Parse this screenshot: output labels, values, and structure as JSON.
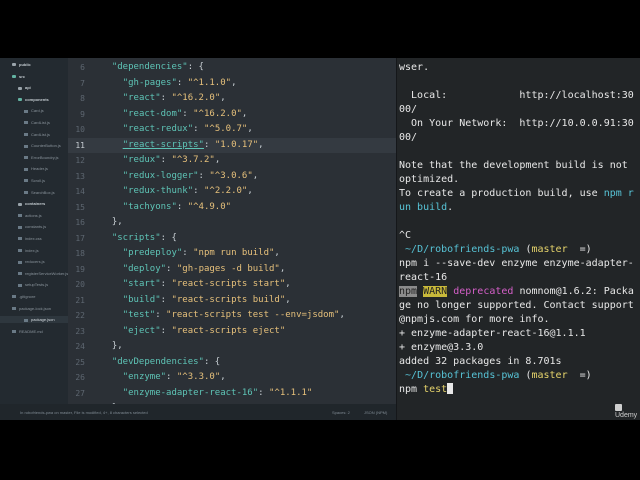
{
  "sidebar": {
    "items": [
      {
        "label": "public",
        "type": "folder",
        "indent": 1
      },
      {
        "label": "src",
        "type": "folder-open",
        "indent": 1
      },
      {
        "label": "api",
        "type": "folder",
        "indent": 2
      },
      {
        "label": "components",
        "type": "folder-open",
        "indent": 2
      },
      {
        "label": "Card.js",
        "type": "file",
        "indent": 3
      },
      {
        "label": "CardList.js",
        "type": "file",
        "indent": 3
      },
      {
        "label": "CardList.js",
        "type": "file",
        "indent": 3
      },
      {
        "label": "CounterButton.js",
        "type": "file",
        "indent": 3
      },
      {
        "label": "ErrorBoundry.js",
        "type": "file",
        "indent": 3
      },
      {
        "label": "Header.js",
        "type": "file",
        "indent": 3
      },
      {
        "label": "Scroll.js",
        "type": "file",
        "indent": 3
      },
      {
        "label": "SearchBox.js",
        "type": "file",
        "indent": 3
      },
      {
        "label": "containers",
        "type": "folder",
        "indent": 2
      },
      {
        "label": "actions.js",
        "type": "file",
        "indent": 2
      },
      {
        "label": "constants.js",
        "type": "file",
        "indent": 2
      },
      {
        "label": "index.css",
        "type": "file",
        "indent": 2
      },
      {
        "label": "index.js",
        "type": "file",
        "indent": 2
      },
      {
        "label": "reducers.js",
        "type": "file",
        "indent": 2
      },
      {
        "label": "registerServiceWorker.js",
        "type": "file",
        "indent": 2
      },
      {
        "label": "setupTests.js",
        "type": "file",
        "indent": 2
      },
      {
        "label": ".gitignore",
        "type": "file",
        "indent": 1
      },
      {
        "label": "package-lock.json",
        "type": "file",
        "indent": 1
      },
      {
        "label": "package.json",
        "type": "file",
        "indent": 1,
        "selected": true
      },
      {
        "label": "README.md",
        "type": "file",
        "indent": 1
      }
    ]
  },
  "editor": {
    "current_line": 11,
    "lines": [
      {
        "n": "6",
        "parts": [
          [
            "p",
            "  "
          ],
          [
            "k",
            "\"dependencies\""
          ],
          [
            "p",
            ": {"
          ]
        ]
      },
      {
        "n": "7",
        "parts": [
          [
            "p",
            "    "
          ],
          [
            "k",
            "\"gh-pages\""
          ],
          [
            "p",
            ": "
          ],
          [
            "s",
            "\"^1.1.0\""
          ],
          [
            "p",
            ","
          ]
        ]
      },
      {
        "n": "8",
        "parts": [
          [
            "p",
            "    "
          ],
          [
            "k",
            "\"react\""
          ],
          [
            "p",
            ": "
          ],
          [
            "s",
            "\"^16.2.0\""
          ],
          [
            "p",
            ","
          ]
        ]
      },
      {
        "n": "9",
        "parts": [
          [
            "p",
            "    "
          ],
          [
            "k",
            "\"react-dom\""
          ],
          [
            "p",
            ": "
          ],
          [
            "s",
            "\"^16.2.0\""
          ],
          [
            "p",
            ","
          ]
        ]
      },
      {
        "n": "10",
        "parts": [
          [
            "p",
            "    "
          ],
          [
            "k",
            "\"react-redux\""
          ],
          [
            "p",
            ": "
          ],
          [
            "s",
            "\"^5.0.7\""
          ],
          [
            "p",
            ","
          ]
        ]
      },
      {
        "n": "11",
        "parts": [
          [
            "p",
            "    "
          ],
          [
            "k ul",
            "\"react-scripts\""
          ],
          [
            "p",
            ": "
          ],
          [
            "s",
            "\"1.0.17\""
          ],
          [
            "p",
            ","
          ]
        ]
      },
      {
        "n": "12",
        "parts": [
          [
            "p",
            "    "
          ],
          [
            "k",
            "\"redux\""
          ],
          [
            "p",
            ": "
          ],
          [
            "s",
            "\"^3.7.2\""
          ],
          [
            "p",
            ","
          ]
        ]
      },
      {
        "n": "13",
        "parts": [
          [
            "p",
            "    "
          ],
          [
            "k",
            "\"redux-logger\""
          ],
          [
            "p",
            ": "
          ],
          [
            "s",
            "\"^3.0.6\""
          ],
          [
            "p",
            ","
          ]
        ]
      },
      {
        "n": "14",
        "parts": [
          [
            "p",
            "    "
          ],
          [
            "k",
            "\"redux-thunk\""
          ],
          [
            "p",
            ": "
          ],
          [
            "s",
            "\"^2.2.0\""
          ],
          [
            "p",
            ","
          ]
        ]
      },
      {
        "n": "15",
        "parts": [
          [
            "p",
            "    "
          ],
          [
            "k",
            "\"tachyons\""
          ],
          [
            "p",
            ": "
          ],
          [
            "s",
            "\"^4.9.0\""
          ]
        ]
      },
      {
        "n": "16",
        "parts": [
          [
            "p",
            "  },"
          ]
        ]
      },
      {
        "n": "17",
        "parts": [
          [
            "p",
            "  "
          ],
          [
            "k",
            "\"scripts\""
          ],
          [
            "p",
            ": {"
          ]
        ]
      },
      {
        "n": "18",
        "parts": [
          [
            "p",
            "    "
          ],
          [
            "k",
            "\"predeploy\""
          ],
          [
            "p",
            ": "
          ],
          [
            "s",
            "\"npm run build\""
          ],
          [
            "p",
            ","
          ]
        ]
      },
      {
        "n": "19",
        "parts": [
          [
            "p",
            "    "
          ],
          [
            "k",
            "\"deploy\""
          ],
          [
            "p",
            ": "
          ],
          [
            "s",
            "\"gh-pages -d build\""
          ],
          [
            "p",
            ","
          ]
        ]
      },
      {
        "n": "20",
        "parts": [
          [
            "p",
            "    "
          ],
          [
            "k",
            "\"start\""
          ],
          [
            "p",
            ": "
          ],
          [
            "s",
            "\"react-scripts start\""
          ],
          [
            "p",
            ","
          ]
        ]
      },
      {
        "n": "21",
        "parts": [
          [
            "p",
            "    "
          ],
          [
            "k",
            "\"build\""
          ],
          [
            "p",
            ": "
          ],
          [
            "s",
            "\"react-scripts build\""
          ],
          [
            "p",
            ","
          ]
        ]
      },
      {
        "n": "22",
        "parts": [
          [
            "p",
            "    "
          ],
          [
            "k",
            "\"test\""
          ],
          [
            "p",
            ": "
          ],
          [
            "s",
            "\"react-scripts test --env=jsdom\""
          ],
          [
            "p",
            ","
          ]
        ]
      },
      {
        "n": "23",
        "parts": [
          [
            "p",
            "    "
          ],
          [
            "k",
            "\"eject\""
          ],
          [
            "p",
            ": "
          ],
          [
            "s",
            "\"react-scripts eject\""
          ]
        ]
      },
      {
        "n": "24",
        "parts": [
          [
            "p",
            "  },"
          ]
        ]
      },
      {
        "n": "25",
        "parts": [
          [
            "p",
            "  "
          ],
          [
            "k",
            "\"devDependencies\""
          ],
          [
            "p",
            ": {"
          ]
        ]
      },
      {
        "n": "26",
        "parts": [
          [
            "p",
            "    "
          ],
          [
            "k",
            "\"enzyme\""
          ],
          [
            "p",
            ": "
          ],
          [
            "s",
            "\"^3.3.0\""
          ],
          [
            "p",
            ","
          ]
        ]
      },
      {
        "n": "27",
        "parts": [
          [
            "p",
            "    "
          ],
          [
            "k",
            "\"enzyme-adapter-react-16\""
          ],
          [
            "p",
            ": "
          ],
          [
            "s",
            "\"^1.1.1\""
          ]
        ]
      },
      {
        "n": "28",
        "parts": [
          [
            "p",
            "  }"
          ]
        ]
      },
      {
        "n": "29",
        "parts": [
          [
            "p",
            "}"
          ]
        ]
      },
      {
        "n": "30",
        "parts": [
          [
            "p",
            ""
          ]
        ]
      }
    ]
  },
  "statusbar": {
    "left": "In robofriends-pwa on master, File is modified, 4+, 8 characters selected",
    "spaces": "Spaces: 2",
    "syntax": "JSON (NPM)"
  },
  "terminal": {
    "lines": [
      [
        [
          "dim",
          "wser."
        ]
      ],
      [
        [
          "dim",
          ""
        ]
      ],
      [
        [
          "dim",
          "  Local:            http://localhost:30"
        ]
      ],
      [
        [
          "dim",
          "00/"
        ]
      ],
      [
        [
          "dim",
          "  On Your Network:  http://10.0.0.91:30"
        ]
      ],
      [
        [
          "dim",
          "00/"
        ]
      ],
      [
        [
          "dim",
          ""
        ]
      ],
      [
        [
          "dim",
          "Note that the development build is not"
        ]
      ],
      [
        [
          "dim",
          "optimized."
        ]
      ],
      [
        [
          "dim",
          "To create a production build, use "
        ],
        [
          "cyan",
          "npm r"
        ]
      ],
      [
        [
          "cyan",
          "un build"
        ],
        [
          "dim",
          "."
        ]
      ],
      [
        [
          "dim",
          ""
        ]
      ],
      [
        [
          "dim",
          "^C"
        ]
      ],
      [
        [
          "dim",
          " "
        ],
        [
          "cyan",
          "~/D/robofriends-pwa"
        ],
        [
          "dim",
          " ("
        ],
        [
          "yel",
          "master"
        ],
        [
          "dim",
          "  =)"
        ]
      ],
      [
        [
          "dim",
          "npm i --save-dev enzyme enzyme-adapter-"
        ]
      ],
      [
        [
          "dim",
          "react-16"
        ]
      ],
      [
        [
          "badge-npm",
          "npm"
        ],
        [
          "dim",
          " "
        ],
        [
          "badge-warn",
          "WARN"
        ],
        [
          "dim",
          " "
        ],
        [
          "mag",
          "deprecated"
        ],
        [
          "dim",
          " nomnom@1.6.2: Packa"
        ]
      ],
      [
        [
          "dim",
          "ge no longer supported. Contact support"
        ]
      ],
      [
        [
          "dim",
          "@npmjs.com for more info."
        ]
      ],
      [
        [
          "dim",
          "+ enzyme-adapter-react-16@1.1.1"
        ]
      ],
      [
        [
          "dim",
          "+ enzyme@3.3.0"
        ]
      ],
      [
        [
          "dim",
          "added 32 packages in 8.701s"
        ]
      ],
      [
        [
          "dim",
          " "
        ],
        [
          "cyan",
          "~/D/robofriends-pwa"
        ],
        [
          "dim",
          " ("
        ],
        [
          "yel",
          "master"
        ],
        [
          "dim",
          "  =)"
        ]
      ],
      [
        [
          "dim",
          "npm "
        ],
        [
          "yel",
          "test"
        ]
      ]
    ],
    "watermark": "Udemy"
  }
}
